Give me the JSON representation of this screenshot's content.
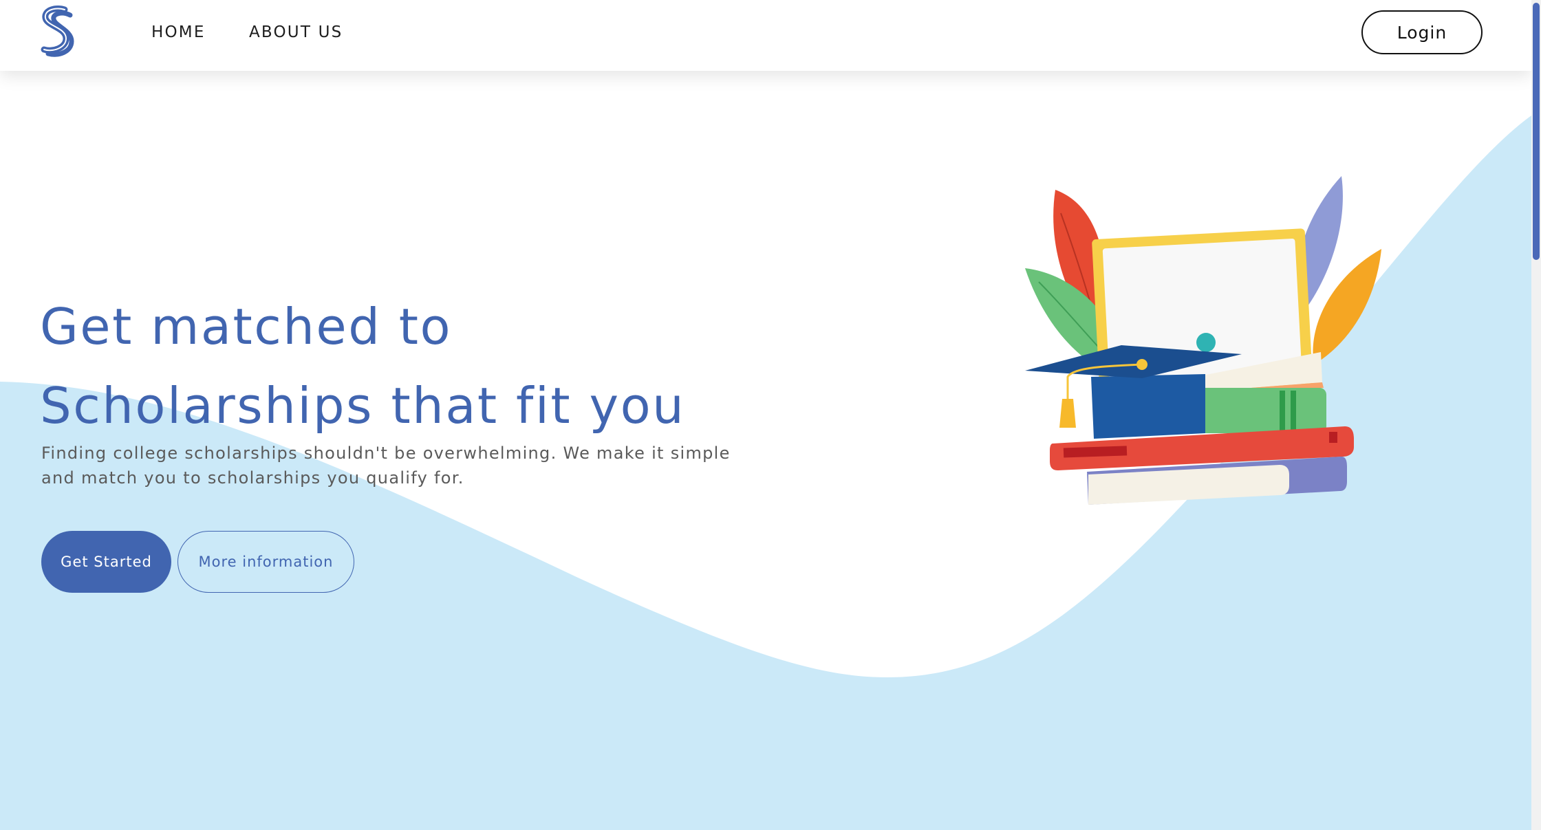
{
  "nav": {
    "links": [
      "HOME",
      "ABOUT US"
    ],
    "login_label": "Login"
  },
  "hero": {
    "title_lines": [
      "Get matched to",
      "Scholarships that fit you"
    ],
    "subtitle": "Finding college scholarships shouldn't be overwhelming. We make it simple and match you to scholarships you qualify for.",
    "primary_button": "Get Started",
    "secondary_button": "More information"
  },
  "icons": {
    "logo": "brand-s-logo",
    "illustration": "graduation-books-illustration"
  },
  "colors": {
    "brand_blue": "#4165b0",
    "wave_light_blue": "#cbe9f8",
    "text_gray": "#5a5a5a",
    "nav_text": "#1d1d1d"
  }
}
